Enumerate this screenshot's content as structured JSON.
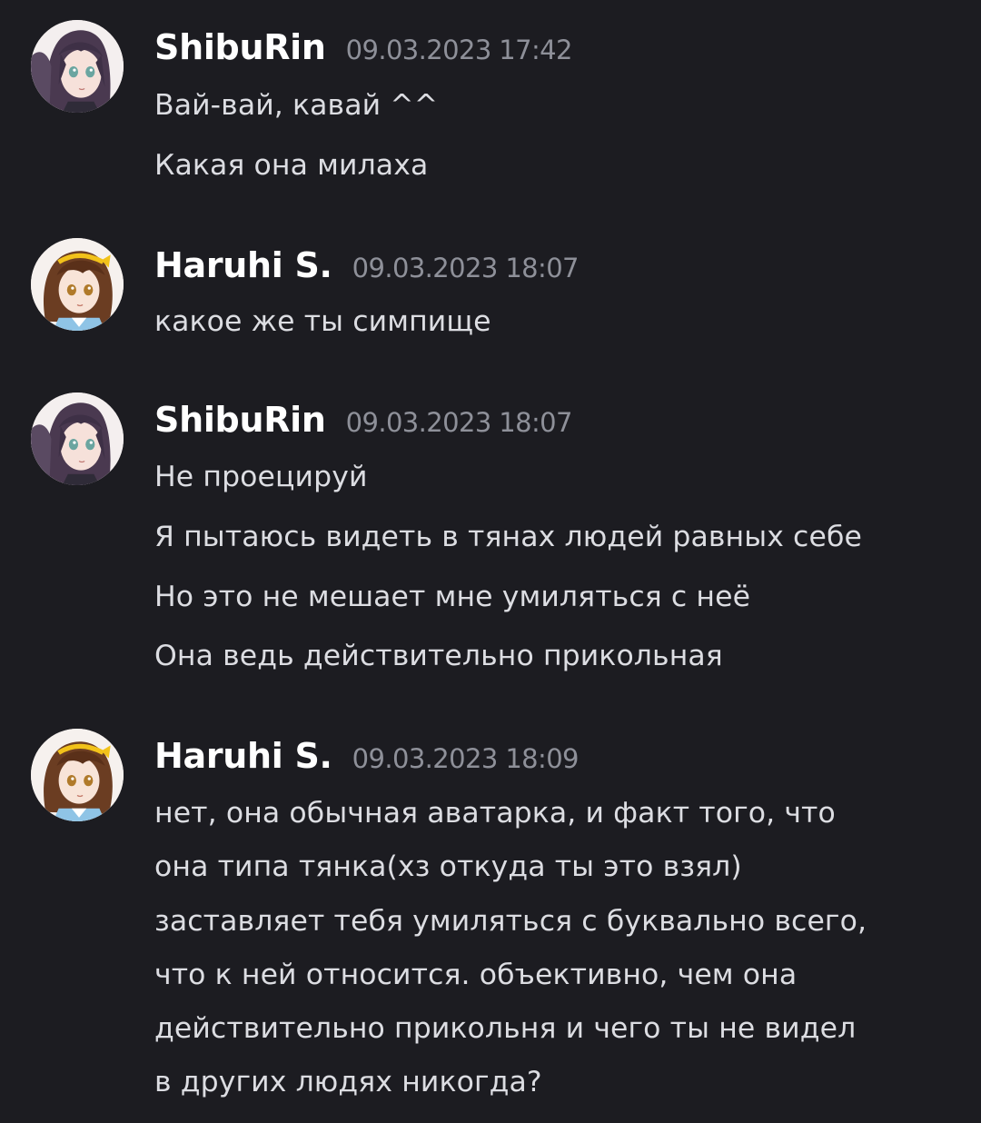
{
  "messages": [
    {
      "author": "ShibuRin",
      "timestamp": "09.03.2023 17:42",
      "avatar_icon": "anime-girl-purple-hair-avatar",
      "lines": [
        "Вай-вай, кавай ^^",
        "Какая она милаха"
      ]
    },
    {
      "author": "Haruhi S.",
      "timestamp": "09.03.2023 18:07",
      "avatar_icon": "anime-girl-brown-hair-yellow-ribbon-avatar",
      "lines": [
        "какое же ты симпище"
      ]
    },
    {
      "author": "ShibuRin",
      "timestamp": "09.03.2023 18:07",
      "avatar_icon": "anime-girl-purple-hair-avatar",
      "lines": [
        "Не проецируй",
        "Я пытаюсь видеть в тянах людей равных себе",
        "Но это не мешает мне умиляться с неё",
        "Она ведь действительно прикольная"
      ]
    },
    {
      "author": "Haruhi S.",
      "timestamp": "09.03.2023 18:09",
      "avatar_icon": "anime-girl-brown-hair-yellow-ribbon-avatar",
      "lines": [
        "нет, она обычная аватарка, и факт того, что",
        "она типа тянка(хз откуда ты это взял)",
        "заставляет тебя умиляться с буквально всего,",
        "что к ней относится. объективно, чем она",
        "действительно прикольня и чего ты не видел",
        "в других людях никогда?"
      ]
    }
  ],
  "colors": {
    "background": "#1c1c21",
    "username": "#ffffff",
    "timestamp": "#8e9099",
    "message_text": "#dcdde2"
  }
}
